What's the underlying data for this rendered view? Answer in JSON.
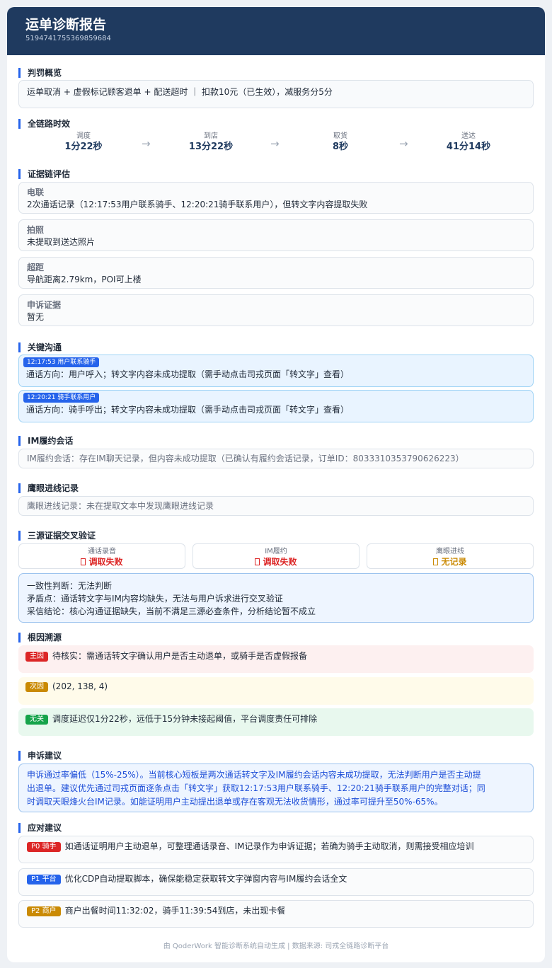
{
  "header": {
    "title": "运单诊断报告",
    "order_id": "5194741755369859684"
  },
  "penalty": {
    "section_title": "判罚概览",
    "summary": "运单取消 + 虚假标记顾客退单 + 配送超时 ｜ 扣款10元（已生效），减服务分5分"
  },
  "timeline": {
    "section_title": "全链路时效",
    "arrow": "→",
    "steps": [
      {
        "label": "调度",
        "value": "1分22秒"
      },
      {
        "label": "到店",
        "value": "13分22秒"
      },
      {
        "label": "取货",
        "value": "8秒"
      },
      {
        "label": "送达",
        "value": "41分14秒"
      }
    ]
  },
  "evidence": {
    "section_title": "证据链评估",
    "items": [
      {
        "label": "电联",
        "text": "2次通话记录（12:17:53用户联系骑手、12:20:21骑手联系用户），但转文字内容提取失败"
      },
      {
        "label": "拍照",
        "text": "未提取到送达照片"
      },
      {
        "label": "超距",
        "text": "导航距离2.79km，POI可上楼"
      },
      {
        "label": "申诉证据",
        "text": "暂无"
      }
    ]
  },
  "communication": {
    "section_title": "关键沟通",
    "items": [
      {
        "tag": "12:17:53  用户联系骑手",
        "text": "通话方向：用户呼入；转文字内容未成功提取（需手动点击司戎页面「转文字」查看）"
      },
      {
        "tag": "12:20:21  骑手联系用户",
        "text": "通话方向：骑手呼出；转文字内容未成功提取（需手动点击司戎页面「转文字」查看）"
      }
    ]
  },
  "im": {
    "section_title": "IM履约会话",
    "text": "IM履约会话：存在IM聊天记录，但内容未成功提取（已确认有履约会话记录，订单ID：8033310353790626223）"
  },
  "eagle": {
    "section_title": "鹰眼进线记录",
    "text": "鹰眼进线记录：未在提取文本中发现鹰眼进线记录"
  },
  "cross_check": {
    "section_title": "三源证据交叉验证",
    "sources": [
      {
        "label": "通话录音",
        "value": "调取失败",
        "color": "#dc2626"
      },
      {
        "label": "IM履约",
        "value": "调取失败",
        "color": "#dc2626"
      },
      {
        "label": "鹰眼进线",
        "value": "无记录",
        "color": "#ca8a04"
      }
    ],
    "consistency": "一致性判断：无法判断",
    "contradiction": "矛盾点：通话转文字与IM内容均缺失，无法与用户诉求进行交叉验证",
    "conclusion": "采信结论：核心沟通证据缺失，当前不满足三源必查条件，分析结论暂不成立"
  },
  "root_cause": {
    "section_title": "根因溯源",
    "items": [
      {
        "tag": "主因",
        "tag_color": "#dc2626",
        "bg": "#fdf0f0",
        "text": "待核实：需通话转文字确认用户是否主动退单，或骑手是否虚假报备"
      },
      {
        "tag": "次因",
        "tag_color": "#ca8a04",
        "bg": "#fffbea",
        "text": "(202, 138, 4)"
      },
      {
        "tag": "无关",
        "tag_color": "#16a34a",
        "bg": "#e8f8ee",
        "text": "调度延迟仅1分22秒，远低于15分钟未接起阈值，平台调度责任可排除"
      }
    ]
  },
  "appeal": {
    "section_title": "申诉建议",
    "lines": [
      "申诉通过率偏低（15%-25%）。当前核心短板是两次通话转文字及IM履约会话内容未成功提取，无法判断用户是否主动提",
      "出退单。建议优先通过司戎页面逐条点击「转文字」获取12:17:53用户联系骑手、12:20:21骑手联系用户的完整对话；同",
      "时调取天眼烽火台IM记录。如能证明用户主动提出退单或存在客观无法收货情形，通过率可提升至50%-65%。"
    ]
  },
  "actions": {
    "section_title": "应对建议",
    "items": [
      {
        "tag": "P0 骑手",
        "tag_color": "#dc2626",
        "text": "如通话证明用户主动退单，可整理通话录音、IM记录作为申诉证据；若确为骑手主动取消，则需接受相应培训"
      },
      {
        "tag": "P1 平台",
        "tag_color": "#2563eb",
        "text": "优化CDP自动提取脚本，确保能稳定获取转文字弹窗内容与IM履约会话全文"
      },
      {
        "tag": "P2 商户",
        "tag_color": "#ca8a04",
        "text": "商户出餐时间11:32:02，骑手11:39:54到店，未出现卡餐"
      }
    ]
  },
  "footer": "由 QoderWork 智能诊断系统自动生成 | 数据来源: 司戎全链路诊断平台"
}
